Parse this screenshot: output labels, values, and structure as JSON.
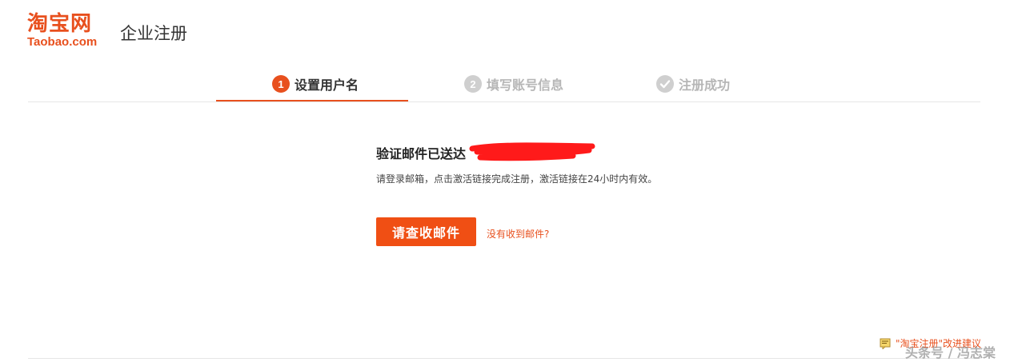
{
  "header": {
    "logo_cn": "淘宝网",
    "logo_en": "Taobao.com",
    "page_title": "企业注册"
  },
  "steps": [
    {
      "num": "1",
      "label": "设置用户名",
      "state": "active"
    },
    {
      "num": "2",
      "label": "填写账号信息",
      "state": "pending"
    },
    {
      "num": "",
      "label": "注册成功",
      "state": "pending"
    }
  ],
  "main": {
    "title": "验证邮件已送达",
    "description": "请登录邮箱，点击激活链接完成注册，激活链接在24小时内有效。",
    "check_button": "请查收邮件",
    "no_mail_link": "没有收到邮件?"
  },
  "footer": {
    "feedback_link": "\"淘宝注册\"改进建议",
    "watermark": "头条号 / 冯志棠"
  },
  "colors": {
    "brand": "#e8501e",
    "button": "#f04f14",
    "inactive": "#cfcfcf"
  }
}
